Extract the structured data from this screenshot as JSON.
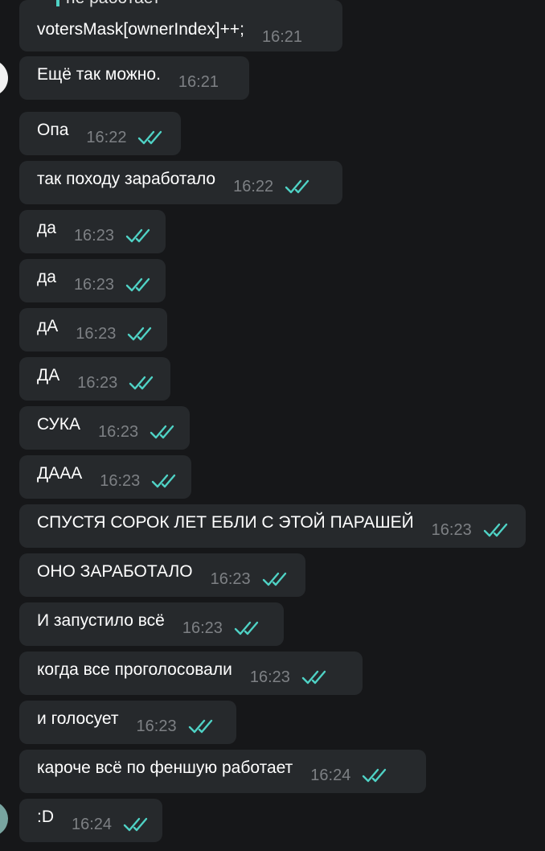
{
  "colors": {
    "background": "#161719",
    "bubble": "#26292c",
    "text": "#ffffff",
    "time": "#7d8084",
    "read_ticks": "#4fd2c5"
  },
  "icons": {
    "read_status": "double-check-icon"
  },
  "chat": {
    "quoted_reply_partial": "не работает",
    "messages": [
      {
        "text": "votersMask[ownerIndex]++;",
        "time": "16:21",
        "outgoing": false
      },
      {
        "text": "Ещё так можно.",
        "time": "16:21",
        "outgoing": false
      },
      {
        "text": "Опа",
        "time": "16:22",
        "outgoing": true
      },
      {
        "text": "так походу заработало",
        "time": "16:22",
        "outgoing": true
      },
      {
        "text": "да",
        "time": "16:23",
        "outgoing": true
      },
      {
        "text": "да",
        "time": "16:23",
        "outgoing": true
      },
      {
        "text": "дА",
        "time": "16:23",
        "outgoing": true
      },
      {
        "text": "ДА",
        "time": "16:23",
        "outgoing": true
      },
      {
        "text": "СУКА",
        "time": "16:23",
        "outgoing": true
      },
      {
        "text": "ДААА",
        "time": "16:23",
        "outgoing": true
      },
      {
        "text": "СПУСТЯ СОРОК ЛЕТ ЕБЛИ С ЭТОЙ ПАРАШЕЙ",
        "time": "16:23",
        "outgoing": true
      },
      {
        "text": "ОНО ЗАРАБОТАЛО",
        "time": "16:23",
        "outgoing": true
      },
      {
        "text": "И запустило всё",
        "time": "16:23",
        "outgoing": true
      },
      {
        "text": "когда все проголосовали",
        "time": "16:23",
        "outgoing": true
      },
      {
        "text": "и голосует",
        "time": "16:23",
        "outgoing": true
      },
      {
        "text": "кароче всё по феншую работает",
        "time": "16:24",
        "outgoing": true
      },
      {
        "text": ":D",
        "time": "16:24",
        "outgoing": true
      }
    ]
  }
}
